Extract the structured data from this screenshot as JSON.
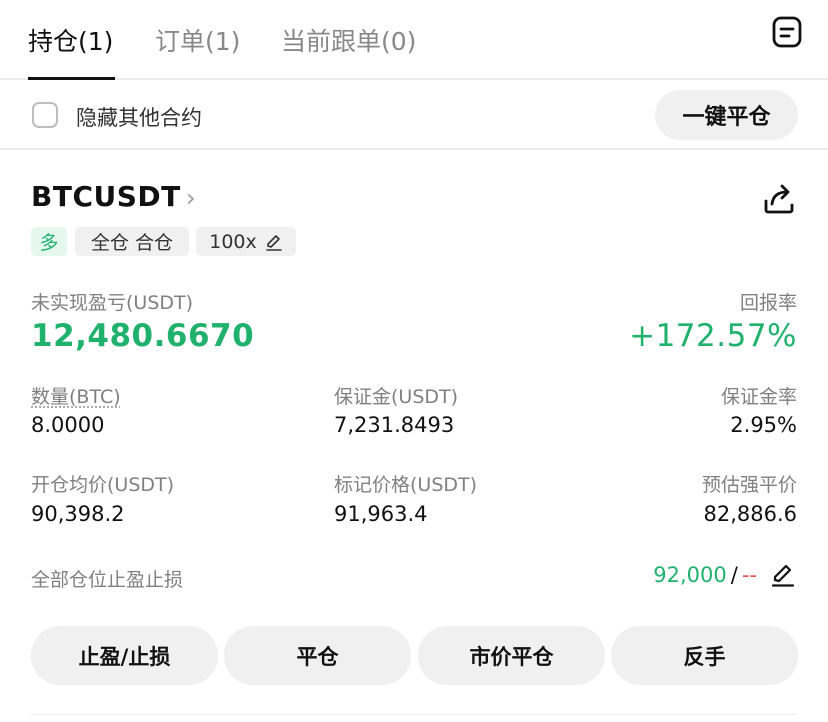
{
  "tabs": [
    {
      "label": "持仓(1)"
    },
    {
      "label": "订单(1)"
    },
    {
      "label": "当前跟单(0)"
    }
  ],
  "filter": {
    "hide_others_label": "隐藏其他合约",
    "checked": false
  },
  "close_all_label": "一键平仓",
  "position": {
    "symbol": "BTCUSDT",
    "side_tag": "多",
    "mode_tag": "全仓 合仓",
    "leverage_tag": "100x",
    "unrealized_pnl_label": "未实现盈亏(USDT)",
    "unrealized_pnl_value": "12,480.6670",
    "roe_label": "回报率",
    "roe_value": "+172.57%",
    "qty_label": "数量(BTC)",
    "qty_value": "8.0000",
    "margin_label": "保证金(USDT)",
    "margin_value": "7,231.8493",
    "margin_ratio_label": "保证金率",
    "margin_ratio_value": "2.95%",
    "entry_label": "开仓均价(USDT)",
    "entry_value": "90,398.2",
    "mark_label": "标记价格(USDT)",
    "mark_value": "91,963.4",
    "liq_label": "预估强平价",
    "liq_value": "82,886.6",
    "tpsl_label": "全部仓位止盈止损",
    "tp_value": "92,000",
    "tpsl_sep": "/",
    "sl_value": "--"
  },
  "actions": [
    "止盈/止损",
    "平仓",
    "市价平仓",
    "反手"
  ],
  "icons": {
    "list": "list-document-icon",
    "share": "share-icon",
    "edit": "edit-pencil-icon",
    "chevron": "chevron-right-icon"
  },
  "colors": {
    "profit": "#20b26c",
    "loss": "#e64f4f",
    "accent": "#111111"
  }
}
